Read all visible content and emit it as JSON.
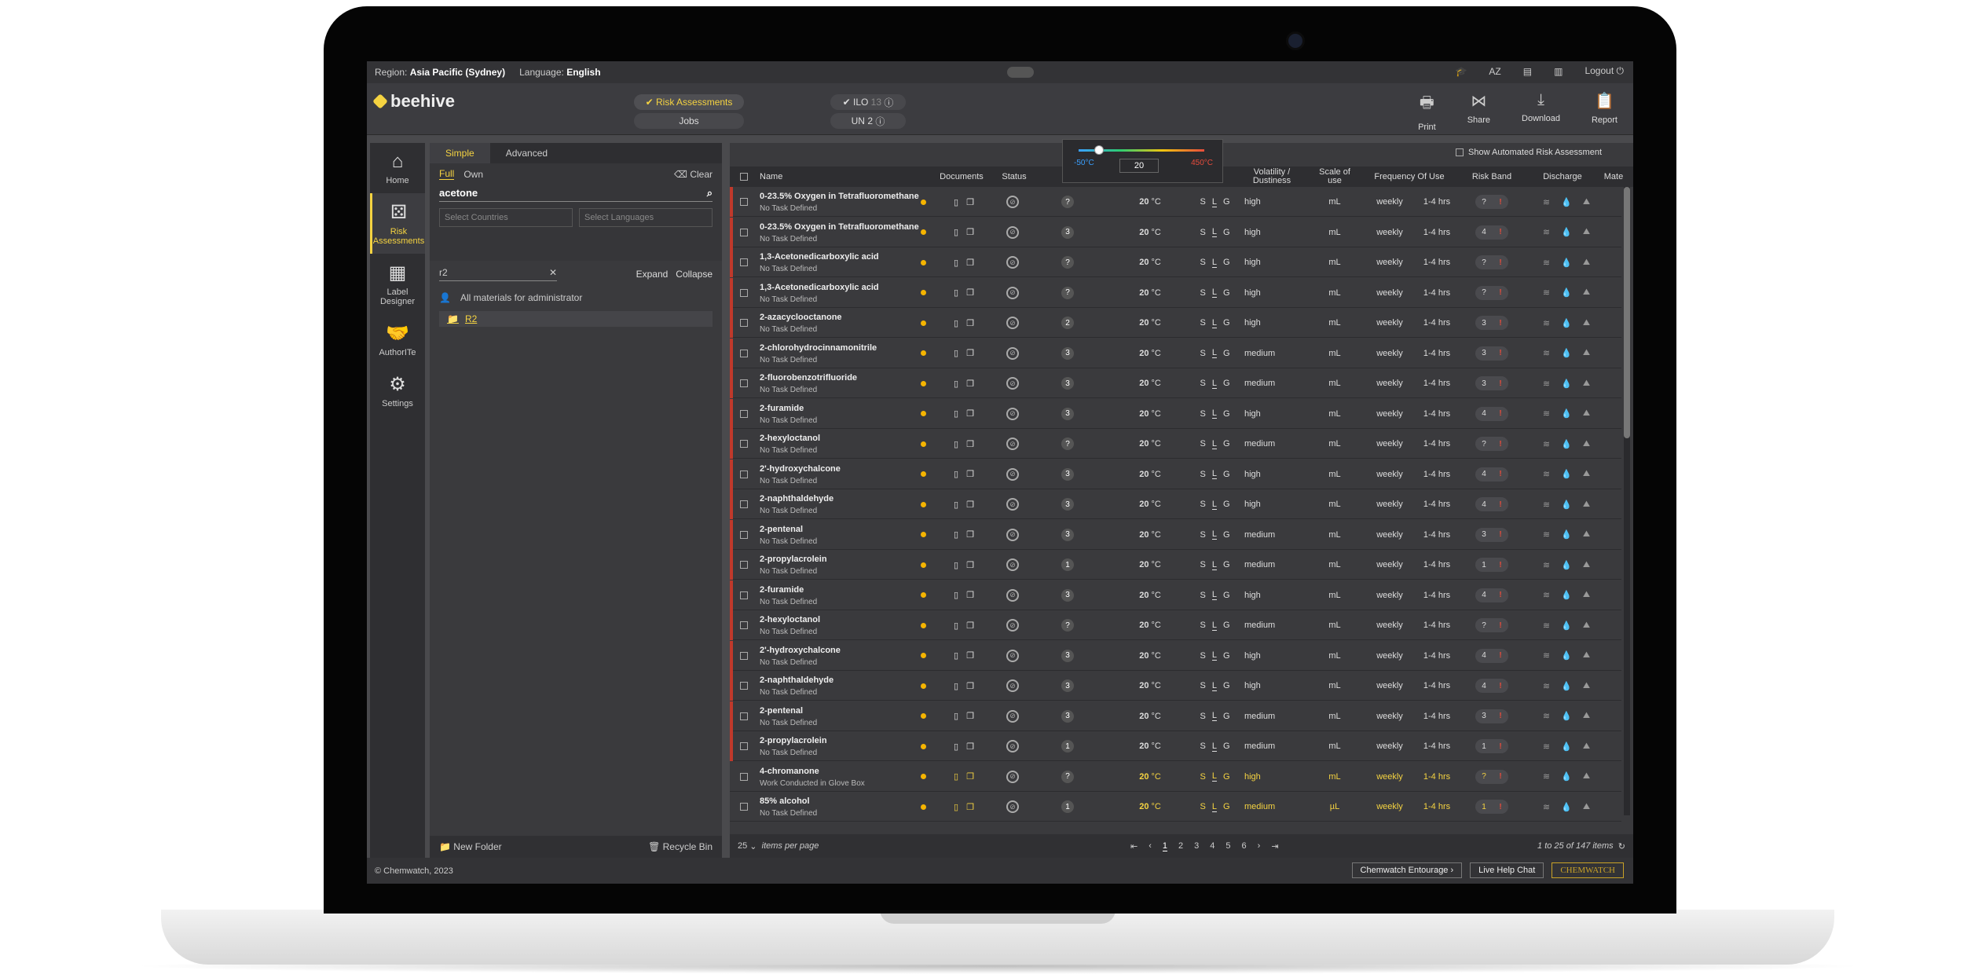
{
  "topbar": {
    "region_label": "Region:",
    "region": "Asia Pacific (Sydney)",
    "language_label": "Language:",
    "language": "English",
    "logout": "Logout",
    "az": "AZ"
  },
  "header": {
    "logo": "beehive",
    "nav_risk": "Risk Assessments",
    "nav_jobs": "Jobs",
    "ilo_label": "ILO",
    "ilo_count": "13",
    "un_label": "UN",
    "un_count": "2",
    "actions": [
      "Print",
      "Share",
      "Download",
      "Report"
    ]
  },
  "leftnav": [
    "Home",
    "Risk Assessments",
    "Label Designer",
    "AuthorITe",
    "Settings"
  ],
  "panel": {
    "tab_simple": "Simple",
    "tab_advanced": "Advanced",
    "full": "Full",
    "own": "Own",
    "clear": "Clear",
    "search_value": "acetone",
    "select_countries": "Select Countries",
    "select_languages": "Select Languages",
    "tree_filter": "r2",
    "expand": "Expand",
    "collapse": "Collapse",
    "all_materials": "All materials for administrator",
    "folder": "R2",
    "new_folder": "New Folder",
    "recycle_bin": "Recycle Bin"
  },
  "temp_popup": {
    "min": "-50°C",
    "max": "450°C",
    "value": "20"
  },
  "grid": {
    "show_automated": "Show Automated Risk Assessment",
    "headers": {
      "name": "Name",
      "documents": "Documents",
      "status": "Status",
      "volatility": "Volatility / Dustiness",
      "scale": "Scale of use",
      "frequency": "Frequency Of Use",
      "risk_band": "Risk Band",
      "discharge": "Discharge",
      "discharge_sub": [
        "Air",
        "Water",
        "Land"
      ],
      "mate": "Mate"
    },
    "rows": [
      {
        "name": "0-23.5% Oxygen in Tetrafluoromethane",
        "task": "No Task Defined",
        "badge": "?",
        "temp": "20",
        "temp_unit": "°C",
        "vol": "high",
        "scale": "mL",
        "freq": "weekly",
        "hrs": "1-4 hrs",
        "rb": "?"
      },
      {
        "name": "0-23.5% Oxygen in Tetrafluoromethane",
        "task": "No Task Defined",
        "badge": "3",
        "temp": "20",
        "temp_unit": "°C",
        "vol": "high",
        "scale": "mL",
        "freq": "weekly",
        "hrs": "1-4 hrs",
        "rb": "4"
      },
      {
        "name": "1,3-Acetonedicarboxylic acid",
        "task": "No Task Defined",
        "badge": "?",
        "temp": "20",
        "temp_unit": "°C",
        "vol": "high",
        "scale": "mL",
        "freq": "weekly",
        "hrs": "1-4 hrs",
        "rb": "?"
      },
      {
        "name": "1,3-Acetonedicarboxylic acid",
        "task": "No Task Defined",
        "badge": "?",
        "temp": "20",
        "temp_unit": "°C",
        "vol": "high",
        "scale": "mL",
        "freq": "weekly",
        "hrs": "1-4 hrs",
        "rb": "?"
      },
      {
        "name": "2-azacyclooctanone",
        "task": "No Task Defined",
        "badge": "2",
        "temp": "20",
        "temp_unit": "°C",
        "vol": "high",
        "scale": "mL",
        "freq": "weekly",
        "hrs": "1-4 hrs",
        "rb": "3"
      },
      {
        "name": "2-chlorohydrocinnamonitrile",
        "task": "No Task Defined",
        "badge": "3",
        "temp": "20",
        "temp_unit": "°C",
        "vol": "medium",
        "scale": "mL",
        "freq": "weekly",
        "hrs": "1-4 hrs",
        "rb": "3"
      },
      {
        "name": "2-fluorobenzotrifluoride",
        "task": "No Task Defined",
        "badge": "3",
        "temp": "20",
        "temp_unit": "°C",
        "vol": "medium",
        "scale": "mL",
        "freq": "weekly",
        "hrs": "1-4 hrs",
        "rb": "3"
      },
      {
        "name": "2-furamide",
        "task": "No Task Defined",
        "badge": "3",
        "temp": "20",
        "temp_unit": "°C",
        "vol": "high",
        "scale": "mL",
        "freq": "weekly",
        "hrs": "1-4 hrs",
        "rb": "4"
      },
      {
        "name": "2-hexyloctanol",
        "task": "No Task Defined",
        "badge": "?",
        "temp": "20",
        "temp_unit": "°C",
        "vol": "medium",
        "scale": "mL",
        "freq": "weekly",
        "hrs": "1-4 hrs",
        "rb": "?"
      },
      {
        "name": "2'-hydroxychalcone",
        "task": "No Task Defined",
        "badge": "3",
        "temp": "20",
        "temp_unit": "°C",
        "vol": "high",
        "scale": "mL",
        "freq": "weekly",
        "hrs": "1-4 hrs",
        "rb": "4"
      },
      {
        "name": "2-naphthaldehyde",
        "task": "No Task Defined",
        "badge": "3",
        "temp": "20",
        "temp_unit": "°C",
        "vol": "high",
        "scale": "mL",
        "freq": "weekly",
        "hrs": "1-4 hrs",
        "rb": "4"
      },
      {
        "name": "2-pentenal",
        "task": "No Task Defined",
        "badge": "3",
        "temp": "20",
        "temp_unit": "°C",
        "vol": "medium",
        "scale": "mL",
        "freq": "weekly",
        "hrs": "1-4 hrs",
        "rb": "3"
      },
      {
        "name": "2-propylacrolein",
        "task": "No Task Defined",
        "badge": "1",
        "temp": "20",
        "temp_unit": "°C",
        "vol": "medium",
        "scale": "mL",
        "freq": "weekly",
        "hrs": "1-4 hrs",
        "rb": "1"
      },
      {
        "name": "2-furamide",
        "task": "No Task Defined",
        "badge": "3",
        "temp": "20",
        "temp_unit": "°C",
        "vol": "high",
        "scale": "mL",
        "freq": "weekly",
        "hrs": "1-4 hrs",
        "rb": "4"
      },
      {
        "name": "2-hexyloctanol",
        "task": "No Task Defined",
        "badge": "?",
        "temp": "20",
        "temp_unit": "°C",
        "vol": "medium",
        "scale": "mL",
        "freq": "weekly",
        "hrs": "1-4 hrs",
        "rb": "?"
      },
      {
        "name": "2'-hydroxychalcone",
        "task": "No Task Defined",
        "badge": "3",
        "temp": "20",
        "temp_unit": "°C",
        "vol": "high",
        "scale": "mL",
        "freq": "weekly",
        "hrs": "1-4 hrs",
        "rb": "4"
      },
      {
        "name": "2-naphthaldehyde",
        "task": "No Task Defined",
        "badge": "3",
        "temp": "20",
        "temp_unit": "°C",
        "vol": "high",
        "scale": "mL",
        "freq": "weekly",
        "hrs": "1-4 hrs",
        "rb": "4"
      },
      {
        "name": "2-pentenal",
        "task": "No Task Defined",
        "badge": "3",
        "temp": "20",
        "temp_unit": "°C",
        "vol": "medium",
        "scale": "mL",
        "freq": "weekly",
        "hrs": "1-4 hrs",
        "rb": "3"
      },
      {
        "name": "2-propylacrolein",
        "task": "No Task Defined",
        "badge": "1",
        "temp": "20",
        "temp_unit": "°C",
        "vol": "medium",
        "scale": "mL",
        "freq": "weekly",
        "hrs": "1-4 hrs",
        "rb": "1"
      },
      {
        "name": "4-chromanone",
        "task": "Work Conducted in Glove Box",
        "badge": "?",
        "temp": "20",
        "temp_unit": "°C",
        "vol": "high",
        "scale": "mL",
        "freq": "weekly",
        "hrs": "1-4 hrs",
        "rb": "?"
      },
      {
        "name": "85% alcohol",
        "task": "No Task Defined",
        "badge": "1",
        "temp": "20",
        "temp_unit": "°C",
        "vol": "medium",
        "scale": "µL",
        "freq": "weekly",
        "hrs": "1-4 hrs",
        "rb": "1"
      }
    ],
    "footer": {
      "per_page": "25",
      "per_page_label": "items per page",
      "pages": [
        "1",
        "2",
        "3",
        "4",
        "5",
        "6"
      ],
      "count": "1 to 25 of 147 items"
    }
  },
  "bottombar": {
    "copyright": "© Chemwatch, 2023",
    "entourage": "Chemwatch Entourage",
    "live_help": "Live Help Chat",
    "brand": "CHEMWATCH"
  },
  "colors": {
    "accent": "#f5d341",
    "danger": "#e74c3c"
  }
}
